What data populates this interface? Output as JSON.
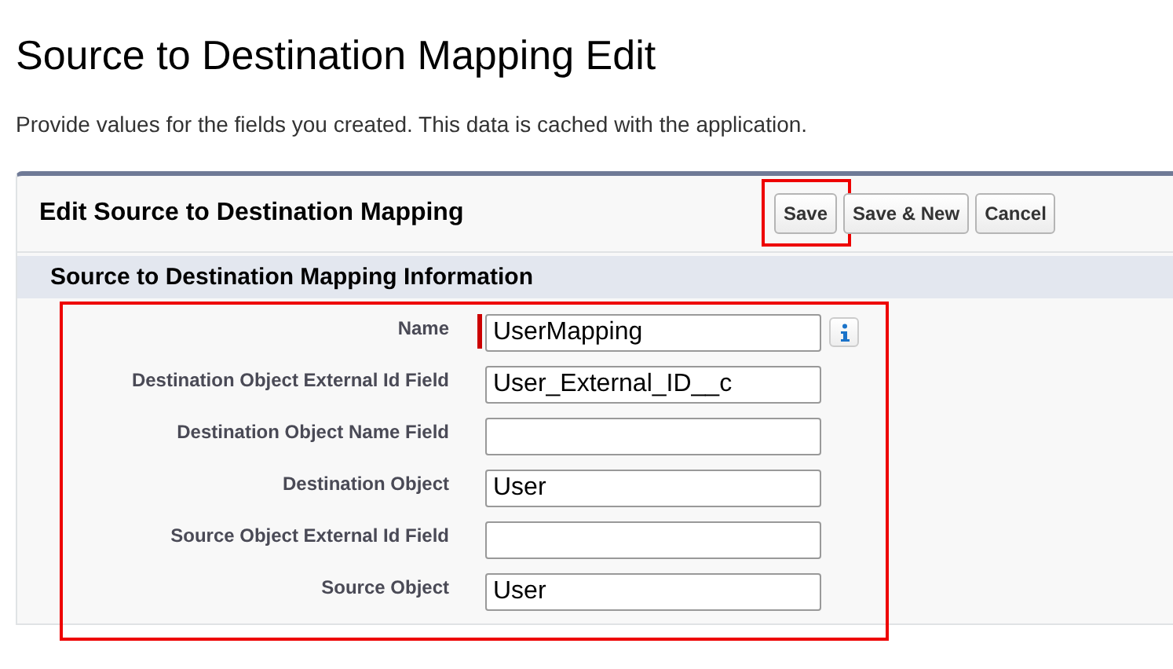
{
  "page": {
    "title": "Source to Destination Mapping Edit",
    "description": "Provide values for the fields you created. This data is cached with the application."
  },
  "panel": {
    "title": "Edit Source to Destination Mapping",
    "buttons": [
      {
        "label": "Save",
        "highlighted": true
      },
      {
        "label": "Save & New",
        "highlighted": false
      },
      {
        "label": "Cancel",
        "highlighted": false
      }
    ],
    "section": {
      "title": "Source to Destination Mapping Information",
      "highlighted": true,
      "fields": [
        {
          "label": "Name",
          "value": "UserMapping",
          "required": true,
          "info": true
        },
        {
          "label": "Destination Object External Id Field",
          "value": "User_External_ID__c",
          "required": false,
          "info": false
        },
        {
          "label": "Destination Object Name Field",
          "required": false,
          "info": false
        },
        {
          "label": "Destination Object",
          "value": "User",
          "required": false,
          "info": false
        },
        {
          "label": "Source Object External Id Field",
          "required": false,
          "info": false
        },
        {
          "label": "Source Object",
          "value": "User",
          "required": false,
          "info": false
        }
      ]
    }
  }
}
